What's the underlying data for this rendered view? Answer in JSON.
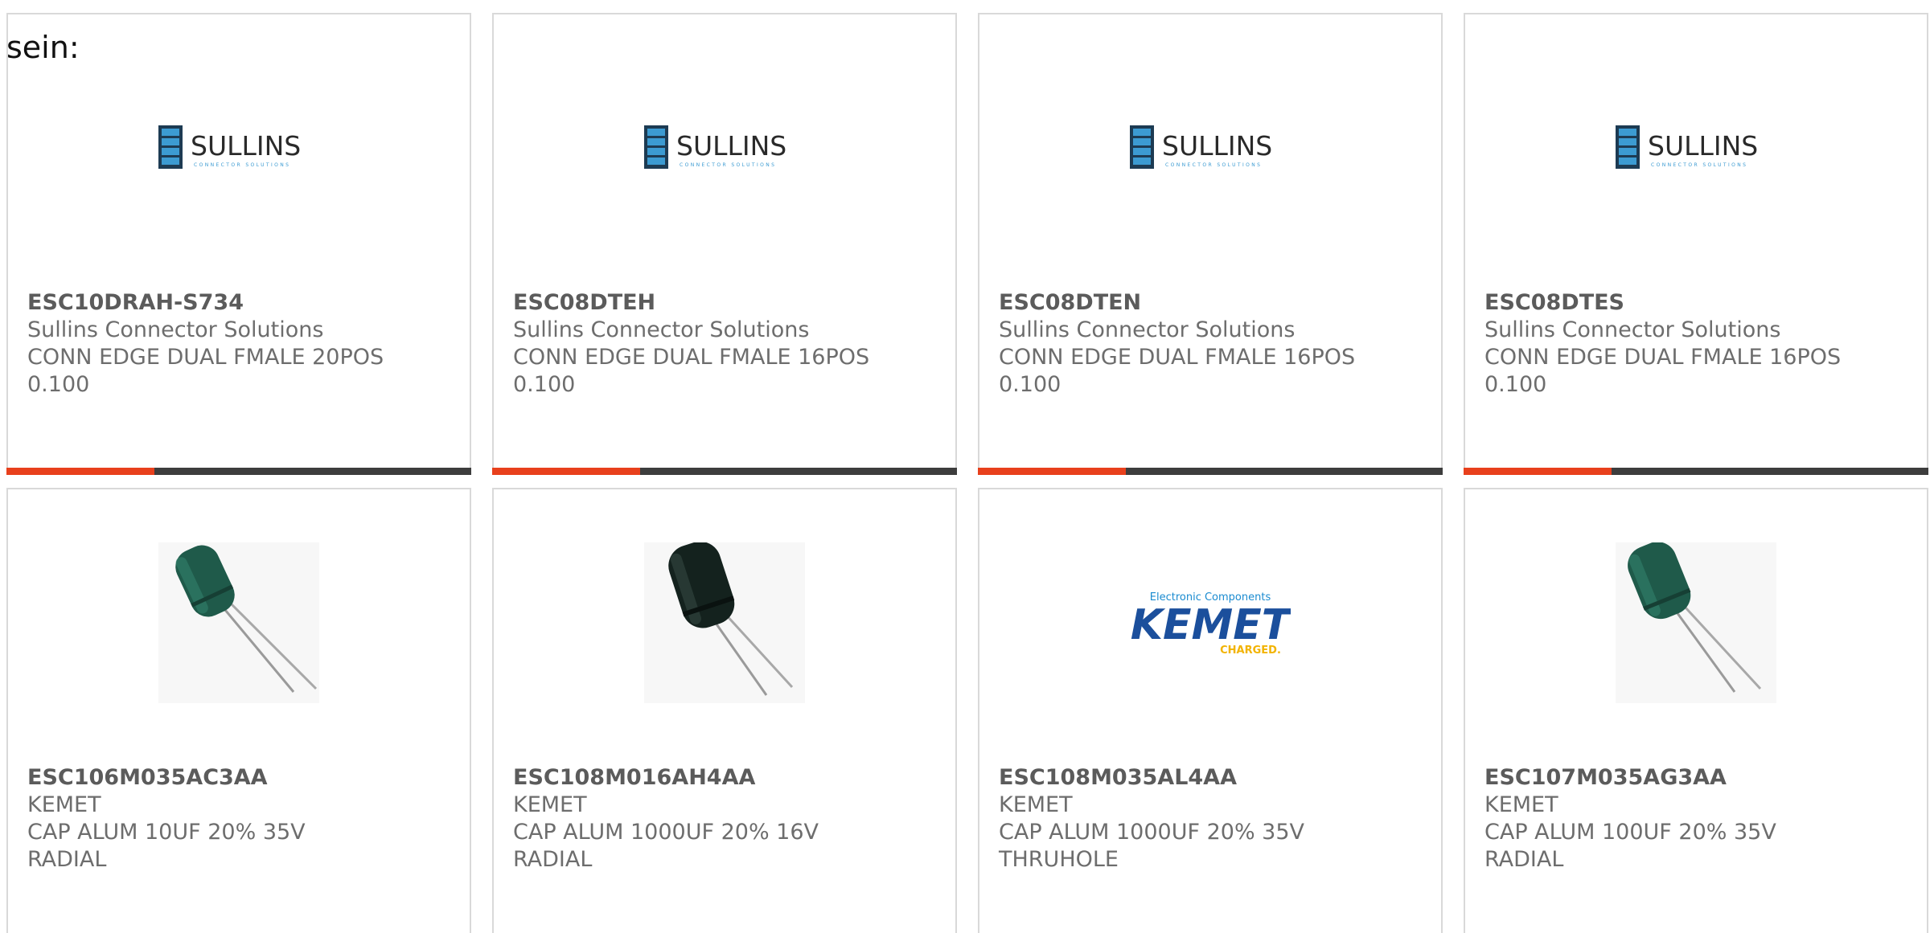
{
  "header": {
    "prefix_text": "sein:"
  },
  "colors": {
    "card_border": "#d9d9d9",
    "accent_bar": "#e8401c",
    "dark_bar": "#3d3d3d",
    "text": "#6d6d6d"
  },
  "products": [
    {
      "part_number": "ESC10DRAH-S734",
      "manufacturer": "Sullins Connector Solutions",
      "description_line1": "CONN EDGE DUAL FMALE 20POS",
      "description_line2": "0.100",
      "image": "sullins-logo",
      "logo_text": "SULLINS",
      "logo_subtext": "CONNECTOR SOLUTIONS"
    },
    {
      "part_number": "ESC08DTEH",
      "manufacturer": "Sullins Connector Solutions",
      "description_line1": "CONN EDGE DUAL FMALE 16POS",
      "description_line2": "0.100",
      "image": "sullins-logo",
      "logo_text": "SULLINS",
      "logo_subtext": "CONNECTOR SOLUTIONS"
    },
    {
      "part_number": "ESC08DTEN",
      "manufacturer": "Sullins Connector Solutions",
      "description_line1": "CONN EDGE DUAL FMALE 16POS",
      "description_line2": "0.100",
      "image": "sullins-logo",
      "logo_text": "SULLINS",
      "logo_subtext": "CONNECTOR SOLUTIONS"
    },
    {
      "part_number": "ESC08DTES",
      "manufacturer": "Sullins Connector Solutions",
      "description_line1": "CONN EDGE DUAL FMALE 16POS",
      "description_line2": "0.100",
      "image": "sullins-logo",
      "logo_text": "SULLINS",
      "logo_subtext": "CONNECTOR SOLUTIONS"
    },
    {
      "part_number": "ESC106M035AC3AA",
      "manufacturer": "KEMET",
      "description_line1": "CAP ALUM 10UF 20% 35V",
      "description_line2": "RADIAL",
      "image": "green-capacitor-photo"
    },
    {
      "part_number": "ESC108M016AH4AA",
      "manufacturer": "KEMET",
      "description_line1": "CAP ALUM 1000UF 20% 16V",
      "description_line2": "RADIAL",
      "image": "black-capacitor-photo"
    },
    {
      "part_number": "ESC108M035AL4AA",
      "manufacturer": "KEMET",
      "description_line1": "CAP ALUM 1000UF 20% 35V",
      "description_line2": "THRUHOLE",
      "image": "kemet-logo",
      "logo_top": "Electronic Components",
      "logo_text": "KEMET",
      "logo_tagline": "CHARGED."
    },
    {
      "part_number": "ESC107M035AG3AA",
      "manufacturer": "KEMET",
      "description_line1": "CAP ALUM 100UF 20% 35V",
      "description_line2": "RADIAL",
      "image": "green-capacitor-photo"
    }
  ]
}
